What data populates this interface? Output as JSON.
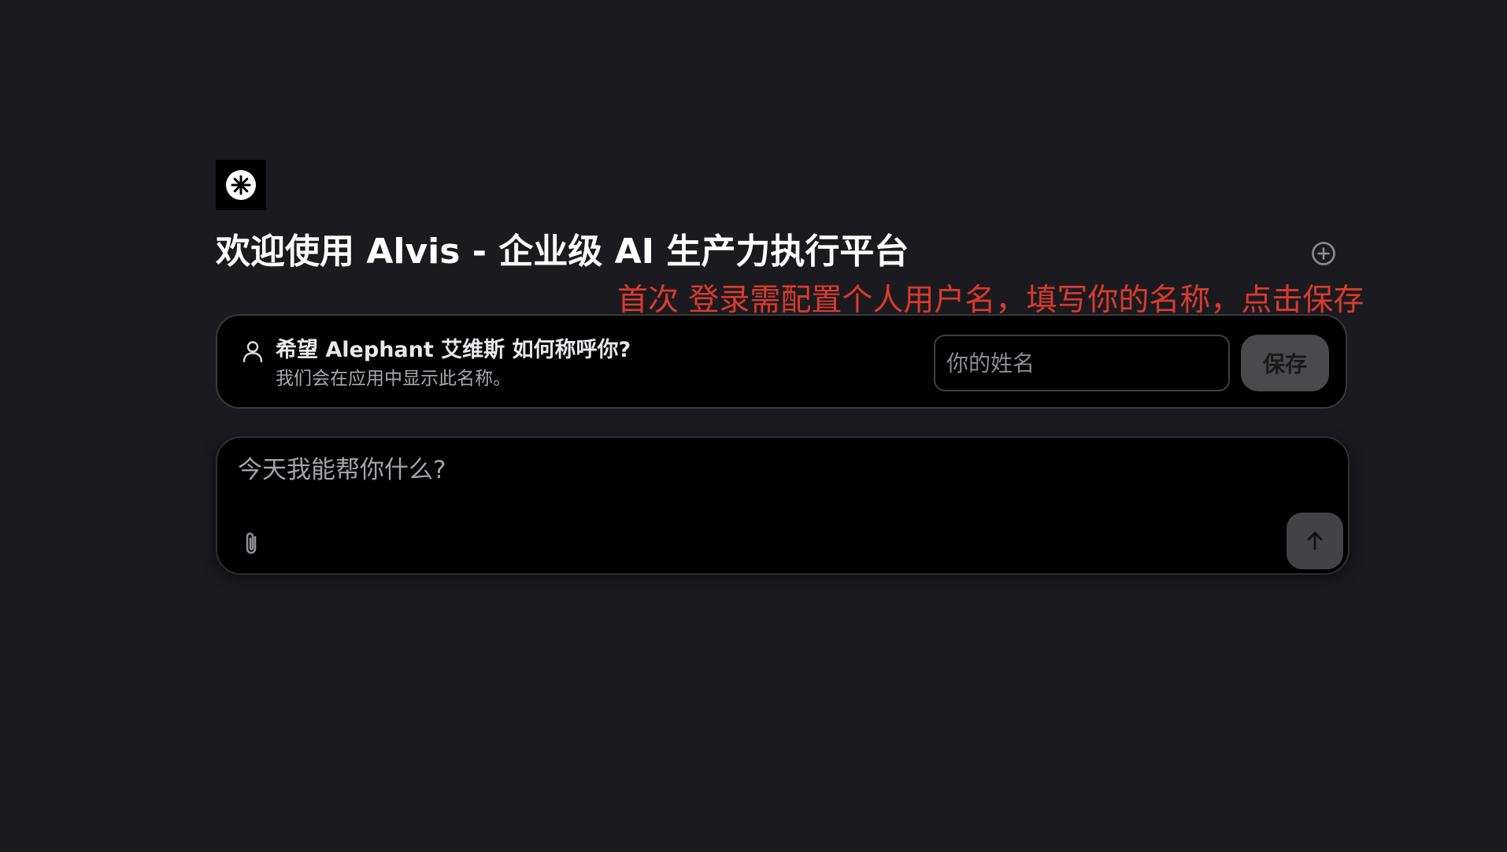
{
  "app": {
    "logo_icon": "asterisk-circle-logo",
    "title": "欢迎使用 Alvis - 企业级 AI 生产力执行平台",
    "new_chat_icon": "plus-circle-icon"
  },
  "annotation": {
    "text": "首次 登录需配置个人用户名，填写你的名称，点击保存",
    "color": "#d93a2f"
  },
  "name_prompt": {
    "icon": "user-icon",
    "heading": "希望 Alephant 艾维斯 如何称呼你?",
    "subtext": "我们会在应用中显示此名称。",
    "input_value": "",
    "input_placeholder": "你的姓名",
    "save_label": "保存"
  },
  "chat": {
    "input_value": "",
    "placeholder": "今天我能帮你什么?",
    "attach_icon": "paperclip-icon",
    "send_icon": "arrow-up-icon"
  },
  "colors": {
    "background": "#1b1b1f",
    "card": "#000000",
    "annotation": "#d93a2f",
    "button": "#4a4a4d"
  }
}
